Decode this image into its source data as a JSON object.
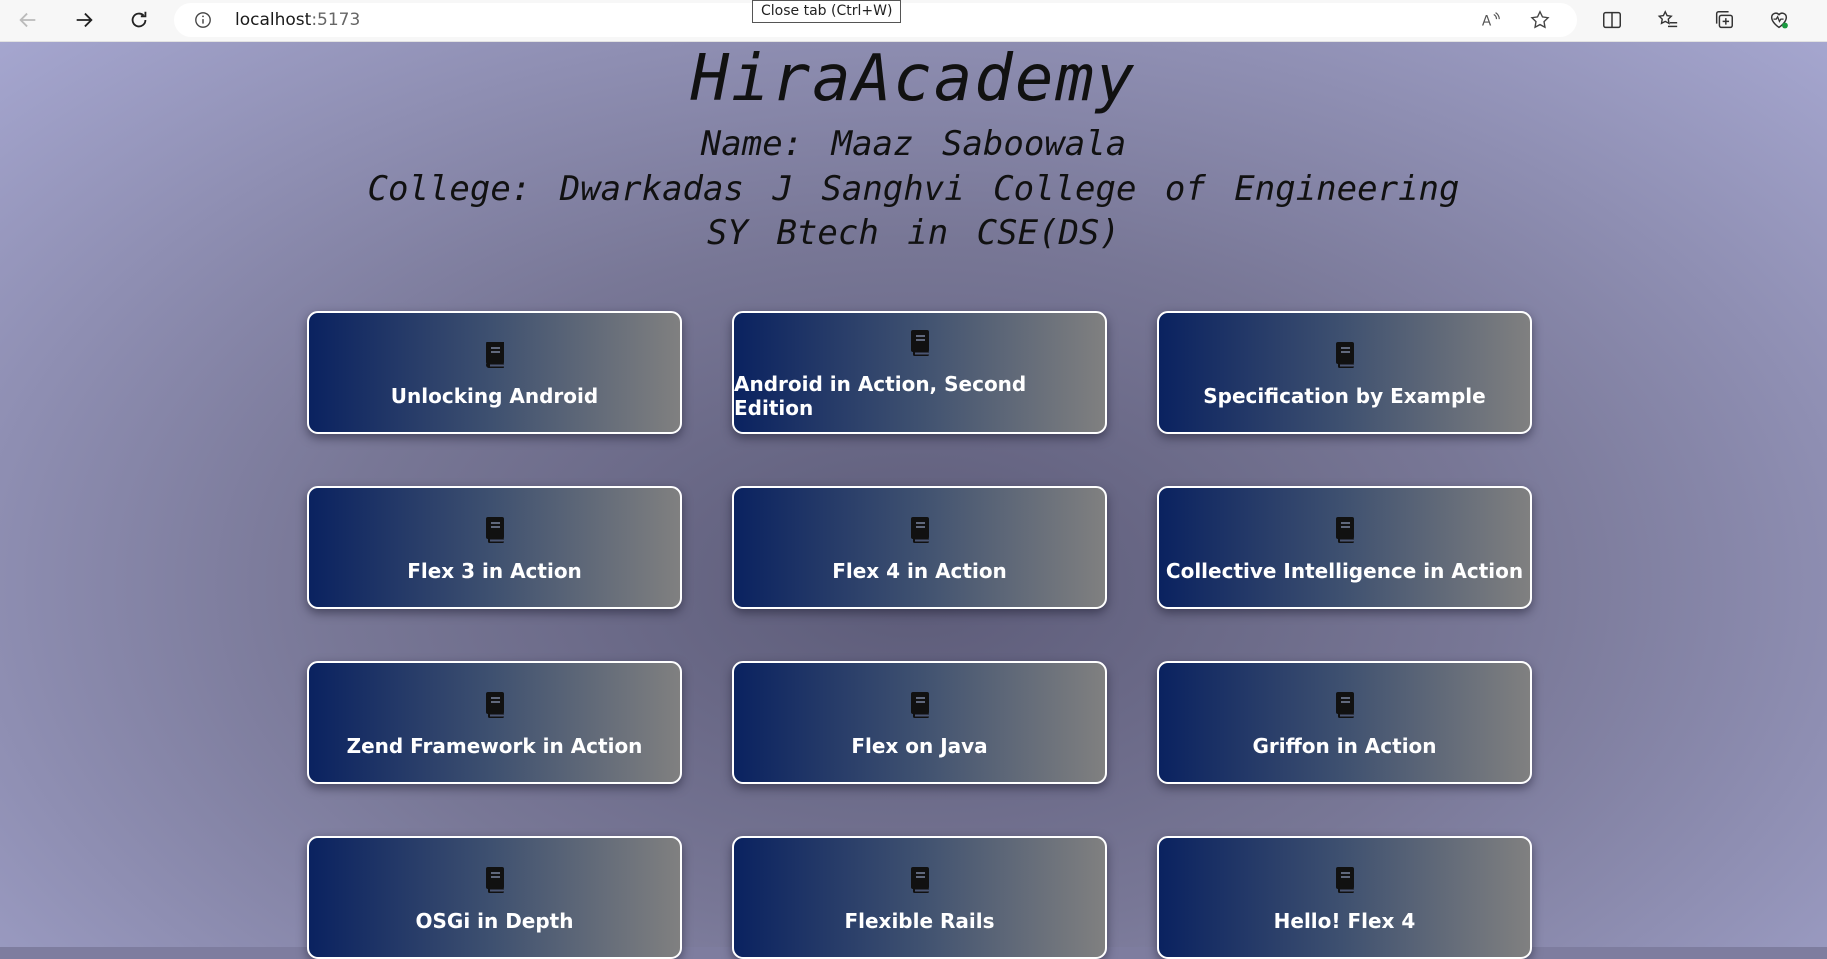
{
  "browser": {
    "url_host": "localhost",
    "url_port": ":5173",
    "tooltip": "Close tab (Ctrl+W)",
    "icons": [
      "back-icon",
      "forward-icon",
      "refresh-icon",
      "info-icon",
      "read-aloud-icon",
      "favorite-star-icon",
      "split-screen-icon",
      "favorites-icon",
      "collections-icon",
      "browser-essentials-icon"
    ]
  },
  "header": {
    "title": "HiraAcademy",
    "name_line": "Name: Maaz Saboowala",
    "college_line": "College: Dwarkadas J Sanghvi College of Engineering",
    "course_line": "SY Btech in CSE(DS)"
  },
  "books": [
    {
      "title": "Unlocking Android",
      "icon": "book-icon"
    },
    {
      "title": "Android in Action, Second Edition",
      "icon": "book-icon"
    },
    {
      "title": "Specification by Example",
      "icon": "book-icon"
    },
    {
      "title": "Flex 3 in Action",
      "icon": "book-icon"
    },
    {
      "title": "Flex 4 in Action",
      "icon": "book-icon"
    },
    {
      "title": "Collective Intelligence in Action",
      "icon": "book-icon"
    },
    {
      "title": "Zend Framework in Action",
      "icon": "book-icon"
    },
    {
      "title": "Flex on Java",
      "icon": "book-icon"
    },
    {
      "title": "Griffon in Action",
      "icon": "book-icon"
    },
    {
      "title": "OSGi in Depth",
      "icon": "book-icon"
    },
    {
      "title": "Flexible Rails",
      "icon": "book-icon"
    },
    {
      "title": "Hello! Flex 4",
      "icon": "book-icon"
    }
  ],
  "colors": {
    "card_gradient_start": "#0a2260",
    "card_gradient_end": "#808080",
    "card_border": "#ffffff",
    "page_background": "#7e7d9f"
  }
}
